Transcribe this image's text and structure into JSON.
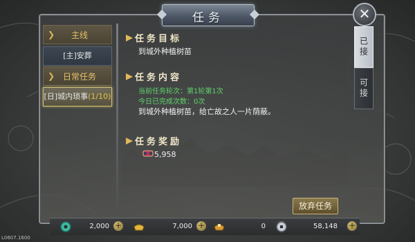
{
  "window": {
    "title": "任务"
  },
  "close": {
    "icon": "close-icon"
  },
  "left_panel": {
    "categories": [
      {
        "label": "主线",
        "tasks": [
          {
            "label": "[主]安葬",
            "progress": ""
          }
        ]
      },
      {
        "label": "日常任务",
        "tasks": [
          {
            "label": "[日]城内琐事",
            "progress": "(1/10)"
          }
        ]
      }
    ]
  },
  "tabs": [
    {
      "label": "已接",
      "active": true
    },
    {
      "label": "可接",
      "active": false
    }
  ],
  "task": {
    "goal_title": "任务目标",
    "goal_text": "到城外种植树苗",
    "content_title": "任务内容",
    "round_line": "当前任务轮次：第1轮第1次",
    "done_line": "今日已完成次数：0次",
    "content_text": "到城外种植树苗，给亡故之人一片荫蔽。",
    "reward_title": "任务奖励",
    "reward_value": "5,958",
    "reward_icon": "exp-scroll-icon"
  },
  "abandon_button": "放弃任务",
  "currencies": [
    {
      "name": "jade-icon",
      "value": "2,000"
    },
    {
      "name": "gold-ingot-icon",
      "value": "7,000"
    },
    {
      "name": "bound-ingot-icon",
      "value": "0"
    },
    {
      "name": "silver-coin-icon",
      "value": "58,148"
    }
  ],
  "footer": {
    "version": "L0607.1600"
  },
  "colors": {
    "accent_gold": "#e6c06a",
    "green_text": "#5fd46a",
    "selected_border": "#d0c27a"
  }
}
